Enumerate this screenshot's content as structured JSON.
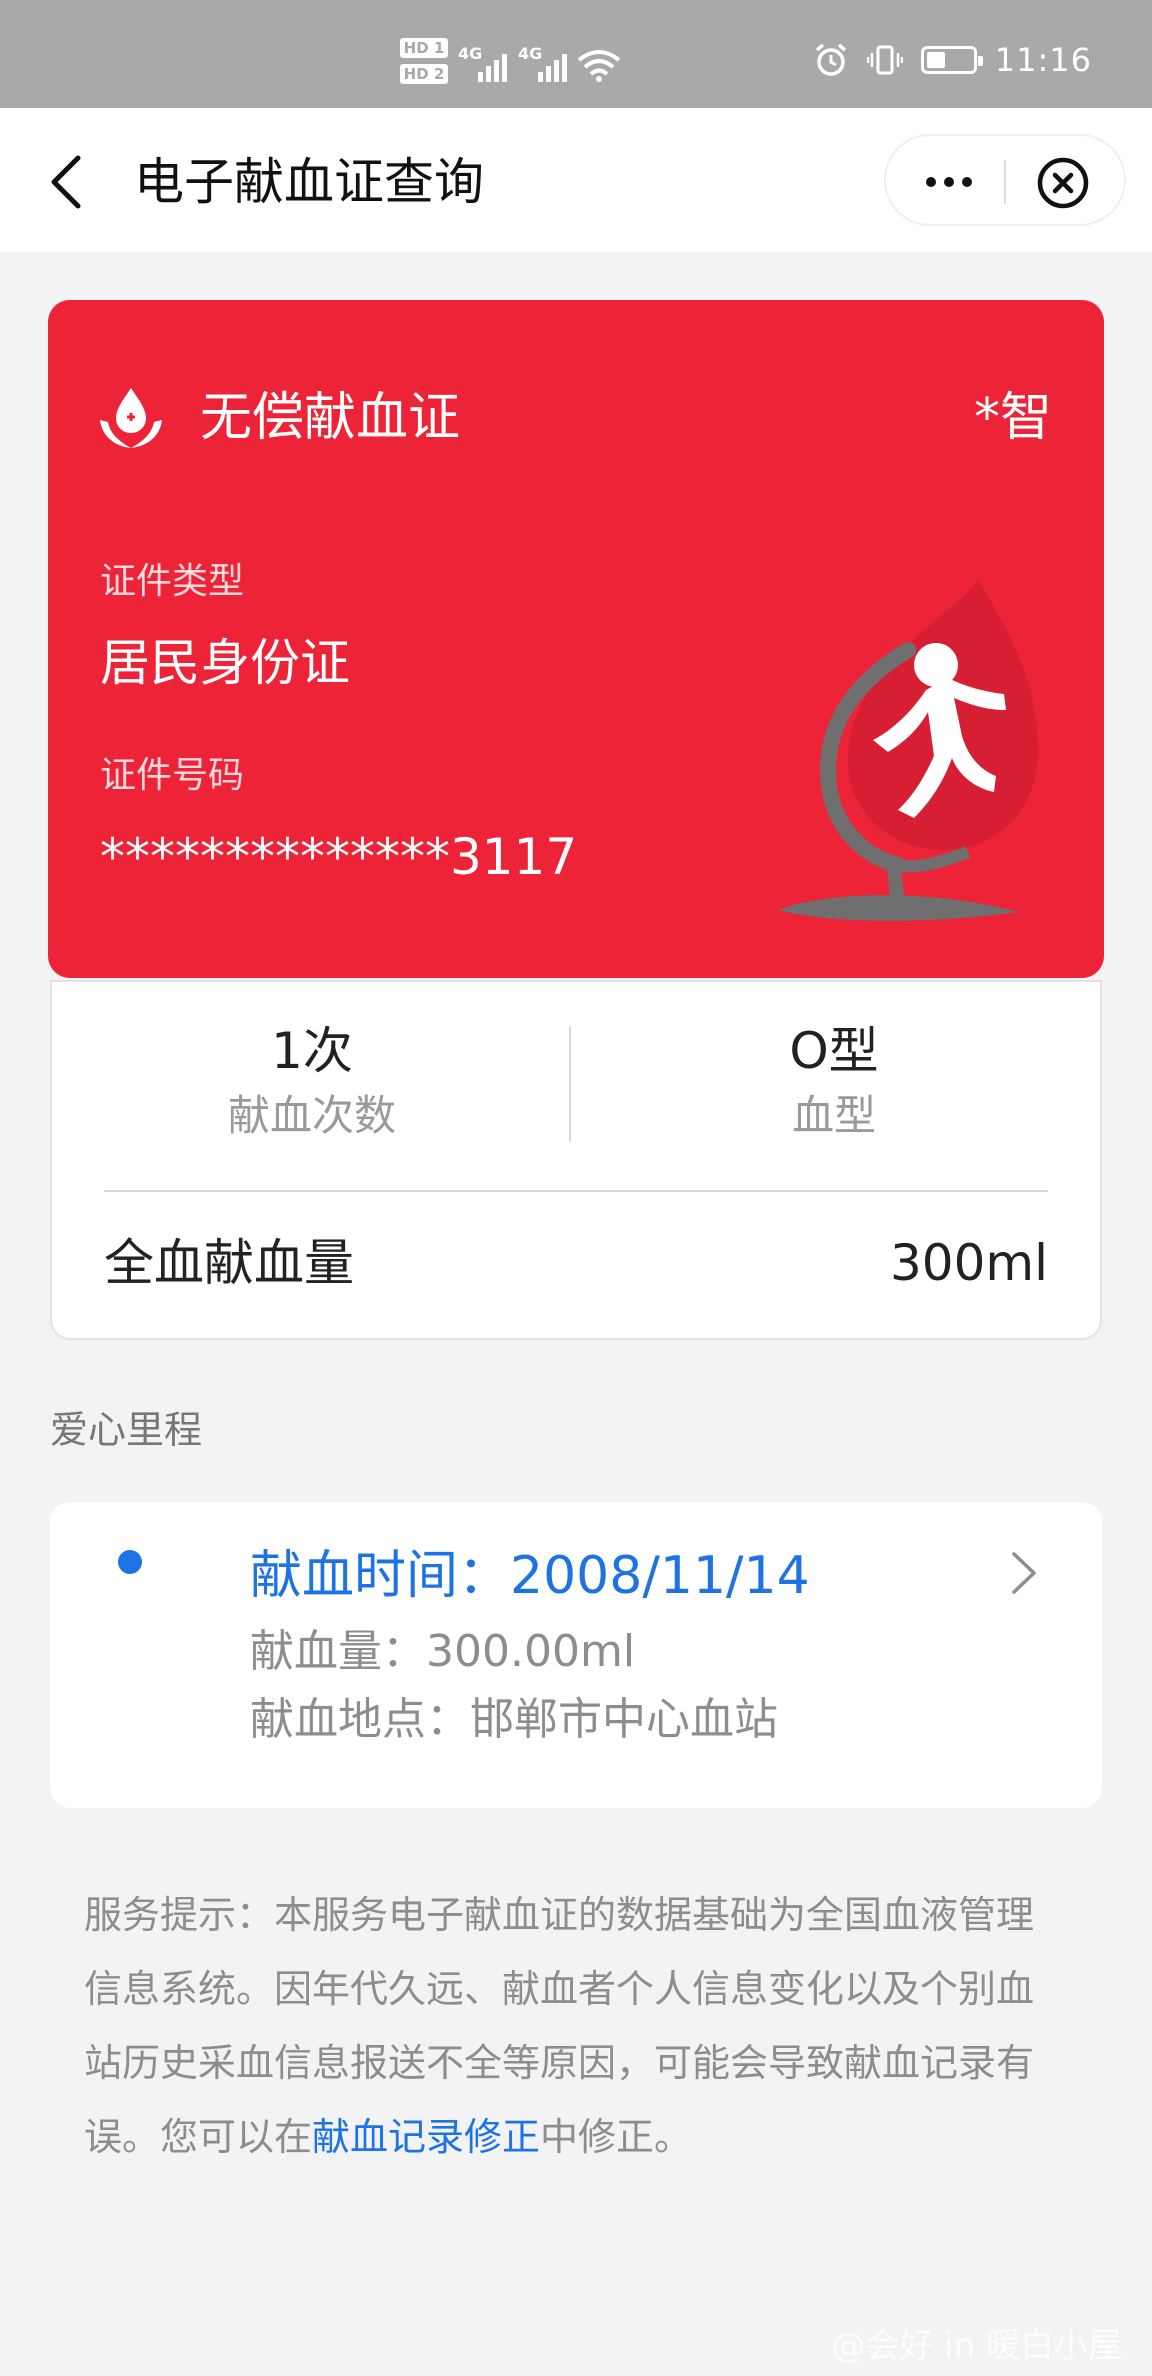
{
  "status_bar": {
    "time": "11:16",
    "sim": [
      "HD 1",
      "HD 2"
    ],
    "network": [
      "4G",
      "4G"
    ],
    "battery_level": 0.4
  },
  "nav": {
    "title": "电子献血证查询",
    "icons": [
      "back-icon",
      "more-icon",
      "close-icon"
    ]
  },
  "card": {
    "title": "无偿献血证",
    "holder": "*智",
    "id_type_label": "证件类型",
    "id_type": "居民身份证",
    "id_number_label": "证件号码",
    "id_number": "**************3117",
    "colors": {
      "card": "#ed2438"
    }
  },
  "stats": {
    "count_value": "1次",
    "count_label": "献血次数",
    "blood_type_value": "O型",
    "blood_type_label": "血型",
    "whole_blood_label": "全血献血量",
    "whole_blood_value": "300ml"
  },
  "journey": {
    "heading": "爱心里程",
    "records": [
      {
        "date": "献血时间：2008/11/14",
        "amount": "献血量：300.00ml",
        "location": "献血地点：邯郸市中心血站"
      }
    ]
  },
  "notice": {
    "text_before": "服务提示：本服务电子献血证的数据基础为全国血液管理信息系统。因年代久远、献血者个人信息变化以及个别血站历史采血信息报送不全等原因，可能会导致献血记录有误。您可以在",
    "link": "献血记录修正",
    "text_after": "中修正。"
  },
  "watermark": "@会好 in 暖白小屋",
  "accent": "#1e73e4"
}
